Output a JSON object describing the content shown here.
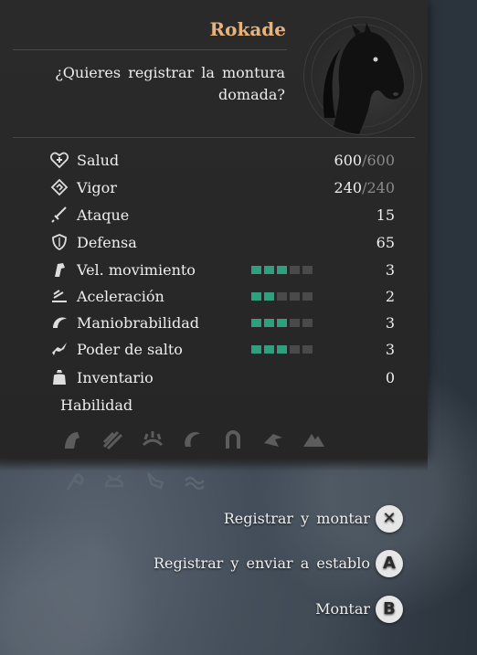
{
  "mount": {
    "name": "Rokade",
    "prompt": "¿Quieres registrar la montura domada?"
  },
  "stats": [
    {
      "icon": "heart-plus-icon",
      "label": "Salud",
      "value": "600",
      "max": "/600"
    },
    {
      "icon": "stamina-icon",
      "label": "Vigor",
      "value": "240",
      "max": "/240"
    },
    {
      "icon": "sword-icon",
      "label": "Ataque",
      "value": "15",
      "max": ""
    },
    {
      "icon": "shield-icon",
      "label": "Defensa",
      "value": "65",
      "max": ""
    },
    {
      "icon": "speed-icon",
      "label": "Vel. movimiento",
      "value": "3",
      "max": "",
      "level": 3,
      "level_max": 5
    },
    {
      "icon": "acceleration-icon",
      "label": "Aceleración",
      "value": "2",
      "max": "",
      "level": 2,
      "level_max": 5
    },
    {
      "icon": "maneuver-icon",
      "label": "Maniobrabilidad",
      "value": "3",
      "max": "",
      "level": 3,
      "level_max": 5
    },
    {
      "icon": "jump-icon",
      "label": "Poder de salto",
      "value": "3",
      "max": "",
      "level": 3,
      "level_max": 5
    },
    {
      "icon": "bag-icon",
      "label": "Inventario",
      "value": "0",
      "max": ""
    }
  ],
  "abilities_label": "Habilidad",
  "colors": {
    "accent": "#e9b27a",
    "bar_on": "#2fa07e",
    "bar_off": "#4a4a4a"
  },
  "actions": [
    {
      "label": "Registrar y montar",
      "button": "✕"
    },
    {
      "label": "Registrar y enviar a establo",
      "button": "A"
    },
    {
      "label": "Montar",
      "button": "B"
    }
  ]
}
